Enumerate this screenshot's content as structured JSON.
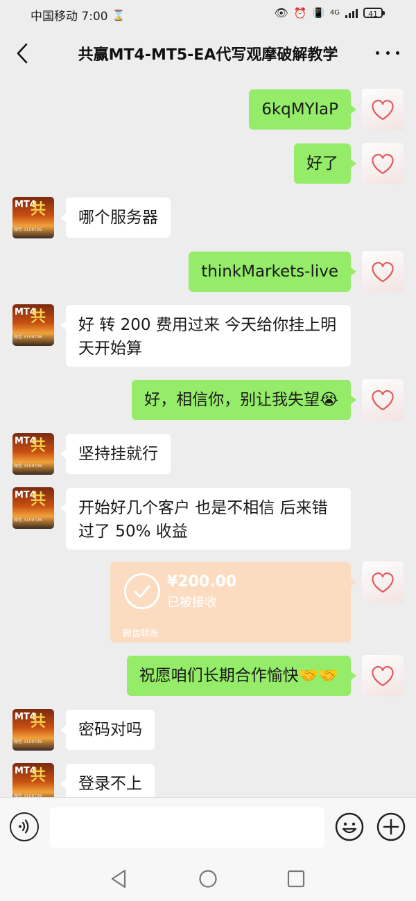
{
  "status": {
    "carrier_time": "中国移动 7:00",
    "network": "4G",
    "battery": "41"
  },
  "nav": {
    "title": "共赢MT4-MT5-EA代写观摩破解教学"
  },
  "contact_avatar": {
    "line1": "MT4",
    "line2": "共",
    "line3": "微信 3159726"
  },
  "messages": [
    {
      "from": "me",
      "text": "6kqMYlaP"
    },
    {
      "from": "me",
      "text": "好了"
    },
    {
      "from": "them",
      "text": "哪个服务器"
    },
    {
      "from": "me",
      "text": "thinkMarkets-live"
    },
    {
      "from": "them",
      "text": "好 转 200 费用过来 今天给你挂上明天开始算"
    },
    {
      "from": "me",
      "text": "好，相信你，别让我失望😭"
    },
    {
      "from": "them",
      "text": "坚持挂就行"
    },
    {
      "from": "them",
      "text": "开始好几个客户 也是不相信 后来错过了 50% 收益"
    },
    {
      "from": "me",
      "text": "祝愿咱们长期合作愉快🤝🤝"
    },
    {
      "from": "them",
      "text": "密码对吗"
    },
    {
      "from": "them",
      "text": "登录不上"
    }
  ],
  "transfer": {
    "amount": "¥200.00",
    "status": "已被接收",
    "label": "微信转账"
  },
  "input": {
    "placeholder": ""
  },
  "colors": {
    "my_bubble": "#95ec69",
    "their_bubble": "#ffffff",
    "background": "#ededed",
    "transfer_card": "#fbdcc1"
  }
}
